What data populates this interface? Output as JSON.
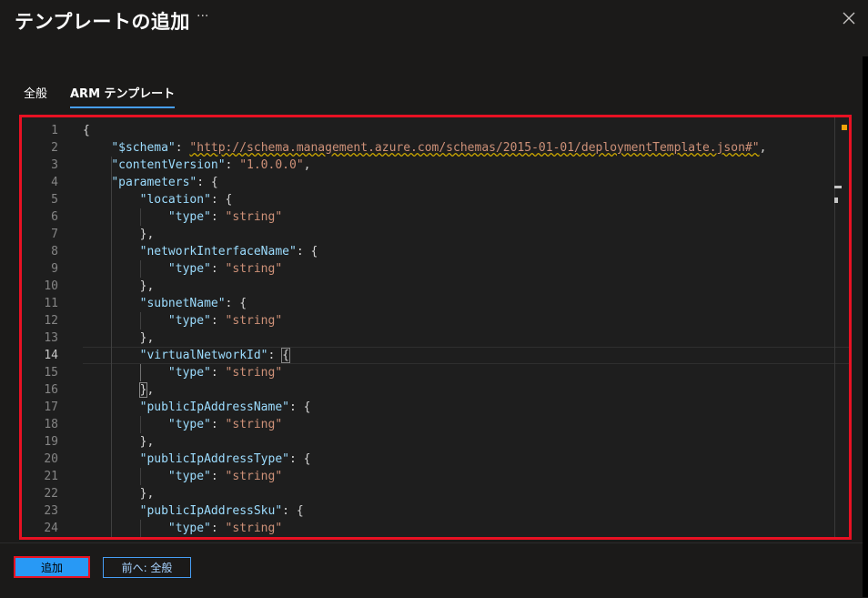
{
  "header": {
    "title": "テンプレートの追加",
    "more_glyph": "···",
    "close_icon": "close-icon"
  },
  "tabs": [
    {
      "label": "全般",
      "active": false
    },
    {
      "label": "ARM テンプレート",
      "active": true
    }
  ],
  "editor": {
    "current_line": 14,
    "lines": [
      {
        "n": "1",
        "segs": [
          {
            "t": "{",
            "c": "p"
          }
        ]
      },
      {
        "n": "2",
        "segs": [
          {
            "t": "    ",
            "c": "p"
          },
          {
            "t": "\"$schema\"",
            "c": "k"
          },
          {
            "t": ": ",
            "c": "p"
          },
          {
            "t": "\"http://schema.management.azure.com/schemas/2015-01-01/deploymentTemplate.json#\"",
            "c": "u"
          },
          {
            "t": ",",
            "c": "p"
          }
        ]
      },
      {
        "n": "3",
        "segs": [
          {
            "t": "    ",
            "c": "p"
          },
          {
            "t": "\"contentVersion\"",
            "c": "k"
          },
          {
            "t": ": ",
            "c": "p"
          },
          {
            "t": "\"1.0.0.0\"",
            "c": "s"
          },
          {
            "t": ",",
            "c": "p"
          }
        ]
      },
      {
        "n": "4",
        "segs": [
          {
            "t": "    ",
            "c": "p"
          },
          {
            "t": "\"parameters\"",
            "c": "k"
          },
          {
            "t": ": {",
            "c": "p"
          }
        ]
      },
      {
        "n": "5",
        "segs": [
          {
            "t": "        ",
            "c": "p"
          },
          {
            "t": "\"location\"",
            "c": "k"
          },
          {
            "t": ": {",
            "c": "p"
          }
        ]
      },
      {
        "n": "6",
        "segs": [
          {
            "t": "            ",
            "c": "p"
          },
          {
            "t": "\"type\"",
            "c": "k"
          },
          {
            "t": ": ",
            "c": "p"
          },
          {
            "t": "\"string\"",
            "c": "s"
          }
        ]
      },
      {
        "n": "7",
        "segs": [
          {
            "t": "        },",
            "c": "p"
          }
        ]
      },
      {
        "n": "8",
        "segs": [
          {
            "t": "        ",
            "c": "p"
          },
          {
            "t": "\"networkInterfaceName\"",
            "c": "k"
          },
          {
            "t": ": {",
            "c": "p"
          }
        ]
      },
      {
        "n": "9",
        "segs": [
          {
            "t": "            ",
            "c": "p"
          },
          {
            "t": "\"type\"",
            "c": "k"
          },
          {
            "t": ": ",
            "c": "p"
          },
          {
            "t": "\"string\"",
            "c": "s"
          }
        ]
      },
      {
        "n": "10",
        "segs": [
          {
            "t": "        },",
            "c": "p"
          }
        ]
      },
      {
        "n": "11",
        "segs": [
          {
            "t": "        ",
            "c": "p"
          },
          {
            "t": "\"subnetName\"",
            "c": "k"
          },
          {
            "t": ": {",
            "c": "p"
          }
        ]
      },
      {
        "n": "12",
        "segs": [
          {
            "t": "            ",
            "c": "p"
          },
          {
            "t": "\"type\"",
            "c": "k"
          },
          {
            "t": ": ",
            "c": "p"
          },
          {
            "t": "\"string\"",
            "c": "s"
          }
        ]
      },
      {
        "n": "13",
        "segs": [
          {
            "t": "        },",
            "c": "p"
          }
        ]
      },
      {
        "n": "14",
        "segs": [
          {
            "t": "        ",
            "c": "p"
          },
          {
            "t": "\"virtualNetworkId\"",
            "c": "k"
          },
          {
            "t": ": ",
            "c": "p"
          },
          {
            "t": "{",
            "c": "br"
          }
        ]
      },
      {
        "n": "15",
        "segs": [
          {
            "t": "            ",
            "c": "p"
          },
          {
            "t": "\"type\"",
            "c": "k"
          },
          {
            "t": ": ",
            "c": "p"
          },
          {
            "t": "\"string\"",
            "c": "s"
          }
        ]
      },
      {
        "n": "16",
        "segs": [
          {
            "t": "        ",
            "c": "p"
          },
          {
            "t": "}",
            "c": "br"
          },
          {
            "t": ",",
            "c": "p"
          }
        ]
      },
      {
        "n": "17",
        "segs": [
          {
            "t": "        ",
            "c": "p"
          },
          {
            "t": "\"publicIpAddressName\"",
            "c": "k"
          },
          {
            "t": ": {",
            "c": "p"
          }
        ]
      },
      {
        "n": "18",
        "segs": [
          {
            "t": "            ",
            "c": "p"
          },
          {
            "t": "\"type\"",
            "c": "k"
          },
          {
            "t": ": ",
            "c": "p"
          },
          {
            "t": "\"string\"",
            "c": "s"
          }
        ]
      },
      {
        "n": "19",
        "segs": [
          {
            "t": "        },",
            "c": "p"
          }
        ]
      },
      {
        "n": "20",
        "segs": [
          {
            "t": "        ",
            "c": "p"
          },
          {
            "t": "\"publicIpAddressType\"",
            "c": "k"
          },
          {
            "t": ": {",
            "c": "p"
          }
        ]
      },
      {
        "n": "21",
        "segs": [
          {
            "t": "            ",
            "c": "p"
          },
          {
            "t": "\"type\"",
            "c": "k"
          },
          {
            "t": ": ",
            "c": "p"
          },
          {
            "t": "\"string\"",
            "c": "s"
          }
        ]
      },
      {
        "n": "22",
        "segs": [
          {
            "t": "        },",
            "c": "p"
          }
        ]
      },
      {
        "n": "23",
        "segs": [
          {
            "t": "        ",
            "c": "p"
          },
          {
            "t": "\"publicIpAddressSku\"",
            "c": "k"
          },
          {
            "t": ": {",
            "c": "p"
          }
        ]
      },
      {
        "n": "24",
        "segs": [
          {
            "t": "            ",
            "c": "p"
          },
          {
            "t": "\"type\"",
            "c": "k"
          },
          {
            "t": ": ",
            "c": "p"
          },
          {
            "t": "\"string\"",
            "c": "s"
          }
        ]
      }
    ]
  },
  "footer": {
    "add_label": "追加",
    "prev_label": "前へ: 全般"
  },
  "colors": {
    "accent": "#2899f5",
    "highlight_border": "#e81123",
    "key": "#9cdcfe",
    "string": "#ce9178"
  }
}
